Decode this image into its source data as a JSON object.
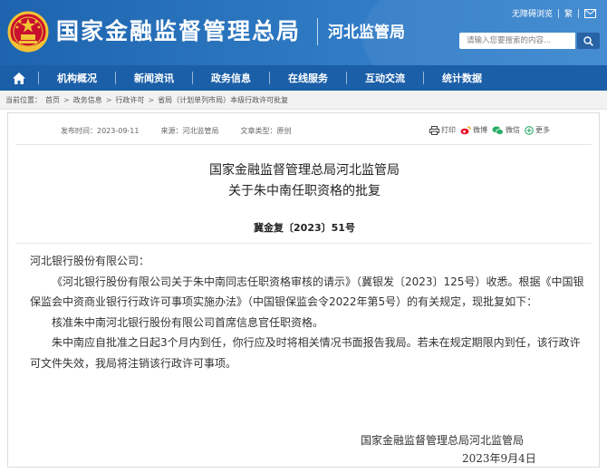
{
  "header": {
    "site_title": "国家金融监督管理总局",
    "sub_title": "河北监管局",
    "top_links": [
      "无障碍浏览",
      "繁"
    ],
    "search_placeholder": "请输入您要搜索的内容...",
    "icons": [
      "national-emblem",
      "mail-icon",
      "search-icon"
    ],
    "colors": {
      "header_blue": "#2f7ac4",
      "nav_blue": "#1b5fa8"
    }
  },
  "nav": {
    "home_icon": "home-icon",
    "items": [
      {
        "label": "机构概况"
      },
      {
        "label": "新闻资讯"
      },
      {
        "label": "政务信息"
      },
      {
        "label": "在线服务"
      },
      {
        "label": "互动交流"
      },
      {
        "label": "统计数据"
      }
    ]
  },
  "breadcrumb": {
    "prefix": "当前位置：",
    "items": [
      "首页",
      "政务信息",
      "行政许可",
      "省局（计划单列市局）本级行政许可批复"
    ]
  },
  "article": {
    "meta": {
      "publish_time": "发布时间：2023-09-11",
      "source": "来源：河北监管局",
      "doc_type": "文章类型：原创"
    },
    "share": {
      "print": "打印",
      "weibo": "微博",
      "wechat": "微信",
      "more": "更多"
    },
    "title_line1": "国家金融监督管理总局河北监管局",
    "title_line2": "关于朱中南任职资格的批复",
    "doc_number": "冀金复〔2023〕51号",
    "salutation": "河北银行股份有限公司：",
    "paragraph1": "《河北银行股份有限公司关于朱中南同志任职资格审核的请示》（冀银发〔2023〕125号）收悉。根据《中国银保监会中资商业银行行政许可事项实施办法》（中国银保监会令2022年第5号）的有关规定，现批复如下：",
    "paragraph2": "核准朱中南河北银行股份有限公司首席信息官任职资格。",
    "paragraph3": "朱中南应自批准之日起3个月内到任，你行应及时将相关情况书面报告我局。若未在规定期限内到任，该行政许可文件失效，我局将注销该行政许可事项。",
    "sign_org": "国家金融监督管理总局河北监管局",
    "sign_date": "2023年9月4日"
  }
}
